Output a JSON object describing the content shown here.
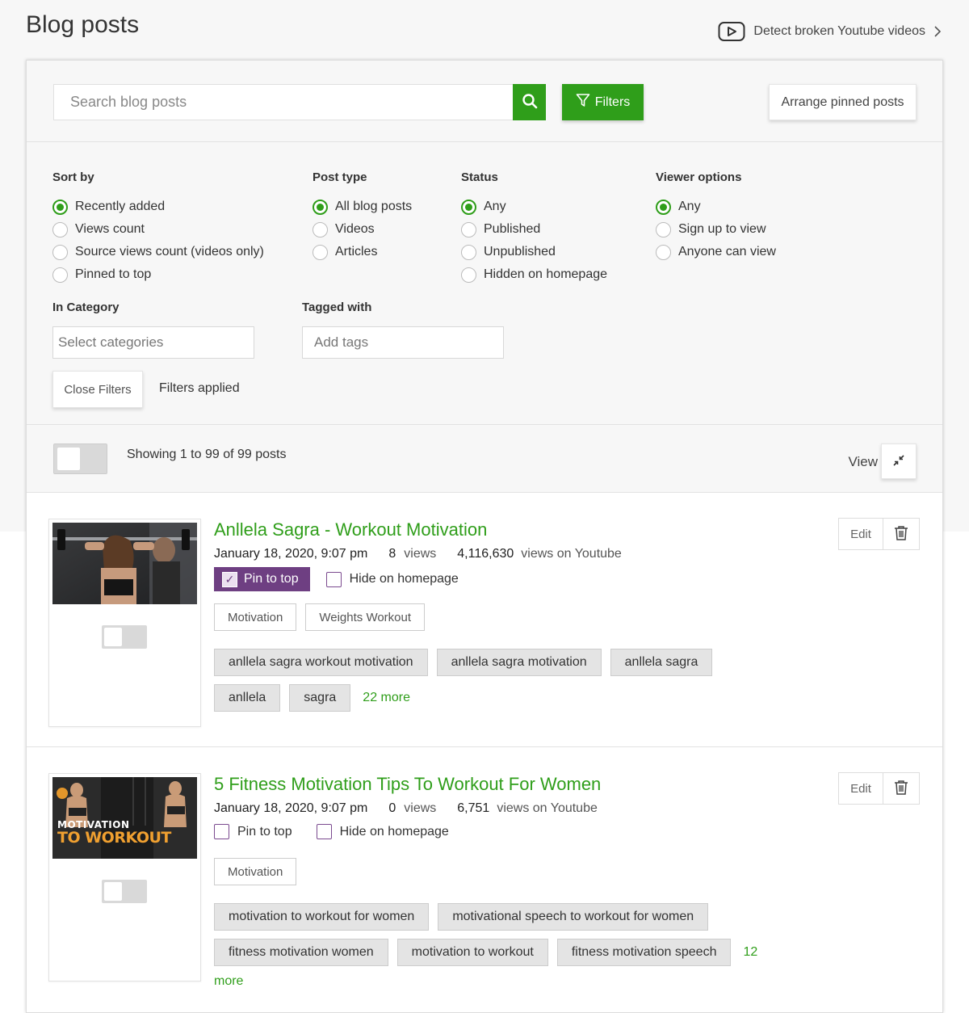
{
  "page": {
    "title": "Blog posts"
  },
  "header": {
    "detect_link": "Detect broken Youtube videos",
    "detect_icon": "youtube-play-icon"
  },
  "toolbar": {
    "search_placeholder": "Search blog posts",
    "filters_label": "Filters",
    "arrange_label": "Arrange pinned posts"
  },
  "filters": {
    "sort_by": {
      "title": "Sort by",
      "options": [
        "Recently added",
        "Views count",
        "Source views count (videos only)",
        "Pinned to top"
      ],
      "selected": 0
    },
    "post_type": {
      "title": "Post type",
      "options": [
        "All blog posts",
        "Videos",
        "Articles"
      ],
      "selected": 0
    },
    "status": {
      "title": "Status",
      "options": [
        "Any",
        "Published",
        "Unpublished",
        "Hidden on homepage"
      ],
      "selected": 0
    },
    "viewer_options": {
      "title": "Viewer options",
      "options": [
        "Any",
        "Sign up to view",
        "Anyone can view"
      ],
      "selected": 0
    },
    "category": {
      "title": "In Category",
      "placeholder": "Select categories"
    },
    "tags": {
      "title": "Tagged with",
      "placeholder": "Add tags"
    },
    "close_label": "Close Filters",
    "applied_label": "Filters applied"
  },
  "listing": {
    "showing": "Showing 1 to 99 of 99 posts",
    "view_label": "View",
    "accent": "#2f9e1a"
  },
  "posts": [
    {
      "title": "Anllela Sagra - Workout Motivation",
      "date": "January 18, 2020, 9:07 pm",
      "views": "8",
      "views_label": "views",
      "yt_views": "4,116,630",
      "yt_label": "views on Youtube",
      "pin_label": "Pin to top",
      "pinned": true,
      "hide_label": "Hide on homepage",
      "categories": [
        "Motivation",
        "Weights Workout"
      ],
      "tags": [
        "anllela sagra workout motivation",
        "anllela sagra motivation",
        "anllela sagra",
        "anllela",
        "sagra"
      ],
      "more": "22 more",
      "edit_label": "Edit"
    },
    {
      "title": "5 Fitness Motivation Tips To Workout For Women",
      "date": "January 18, 2020, 9:07 pm",
      "views": "0",
      "views_label": "views",
      "yt_views": "6,751",
      "yt_label": "views on Youtube",
      "pin_label": "Pin to top",
      "pinned": false,
      "hide_label": "Hide on homepage",
      "thumb_text_1": "MOTIVATION",
      "thumb_text_2": "TO WORKOUT",
      "categories": [
        "Motivation"
      ],
      "tags": [
        "motivation to workout for women",
        "motivational speech to workout for women",
        "fitness motivation women",
        "motivation to workout",
        "fitness motivation speech"
      ],
      "more_1": "12",
      "more_2": "more",
      "edit_label": "Edit"
    }
  ]
}
